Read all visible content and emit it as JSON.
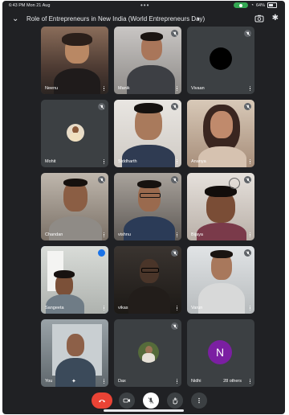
{
  "status": {
    "time": "6:43 PM",
    "date": "Mon 21 Aug",
    "battery": "64%"
  },
  "meeting": {
    "title": "Role of Entrepreneurs in New India (World Entrepreneurs Day)"
  },
  "participants": [
    {
      "name": "Neenu"
    },
    {
      "name": "Manik"
    },
    {
      "name": "Vivaan"
    },
    {
      "name": "Mohit"
    },
    {
      "name": "Siddharth"
    },
    {
      "name": "Ananya"
    },
    {
      "name": "Chandan"
    },
    {
      "name": "vishnu"
    },
    {
      "name": "Bijaya"
    },
    {
      "name": "Sangeeta"
    },
    {
      "name": "vikas"
    },
    {
      "name": "Varun"
    },
    {
      "name": "You"
    },
    {
      "name": "Dax"
    },
    {
      "name": "Nidhi",
      "avatar_letter": "N"
    }
  ],
  "others_label": "28 others",
  "colors": {
    "end_call": "#ea4335",
    "background": "#202124",
    "tile": "#3c4043",
    "active_speaker": "#8ab4f8"
  }
}
